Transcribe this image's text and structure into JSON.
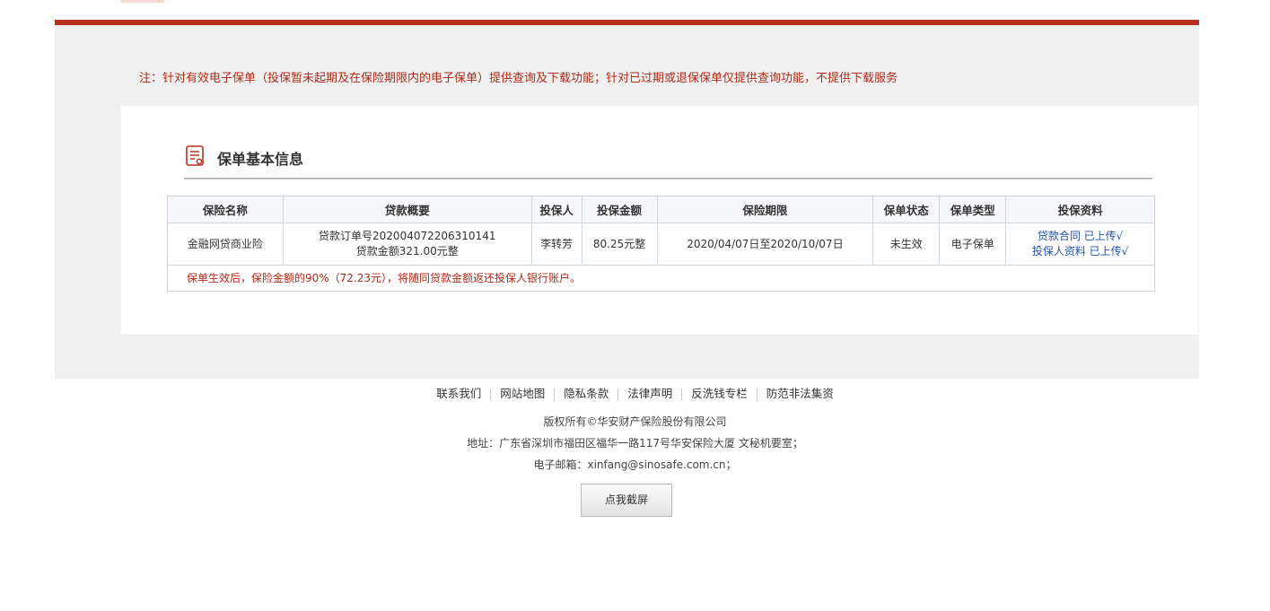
{
  "colors": {
    "accent": "#b8311f",
    "notice_text": "#b02a17",
    "link": "#2553a8",
    "bg_gray": "#f0f0f0"
  },
  "notice": "注：针对有效电子保单（投保暂未起期及在保险期限内的电子保单）提供查询及下载功能；针对已过期或退保保单仅提供查询功能，不提供下载服务",
  "section": {
    "title": "保单基本信息",
    "icon": "document-icon"
  },
  "table": {
    "headers": [
      "保险名称",
      "贷款概要",
      "投保人",
      "投保金额",
      "保险期限",
      "保单状态",
      "保单类型",
      "投保资料"
    ],
    "row": {
      "name": "金融网贷商业险",
      "loan_summary": [
        "贷款订单号202004072206310141",
        "贷款金额321.00元整"
      ],
      "policyholder": "李转芳",
      "amount": "80.25元整",
      "period": "2020/04/07日至2020/10/07日",
      "status": "未生效",
      "type": "电子保单",
      "materials": [
        "贷款合同 已上传√",
        "投保人资料 已上传√"
      ]
    },
    "note": "保单生效后，保险金额的90%（72.23元），将随同贷款金额返还投保人银行账户。"
  },
  "footer": {
    "links": [
      "联系我们",
      "网站地图",
      "隐私条款",
      "法律声明",
      "反洗钱专栏",
      "防范非法集资"
    ],
    "copyright": "版权所有©华安财产保险股份有限公司",
    "address": "地址：广东省深圳市福田区福华一路117号华安保险大厦 文秘机要室；",
    "email": "电子邮箱：xinfang@sinosafe.com.cn；"
  },
  "screenshot_button": "点我截屏"
}
